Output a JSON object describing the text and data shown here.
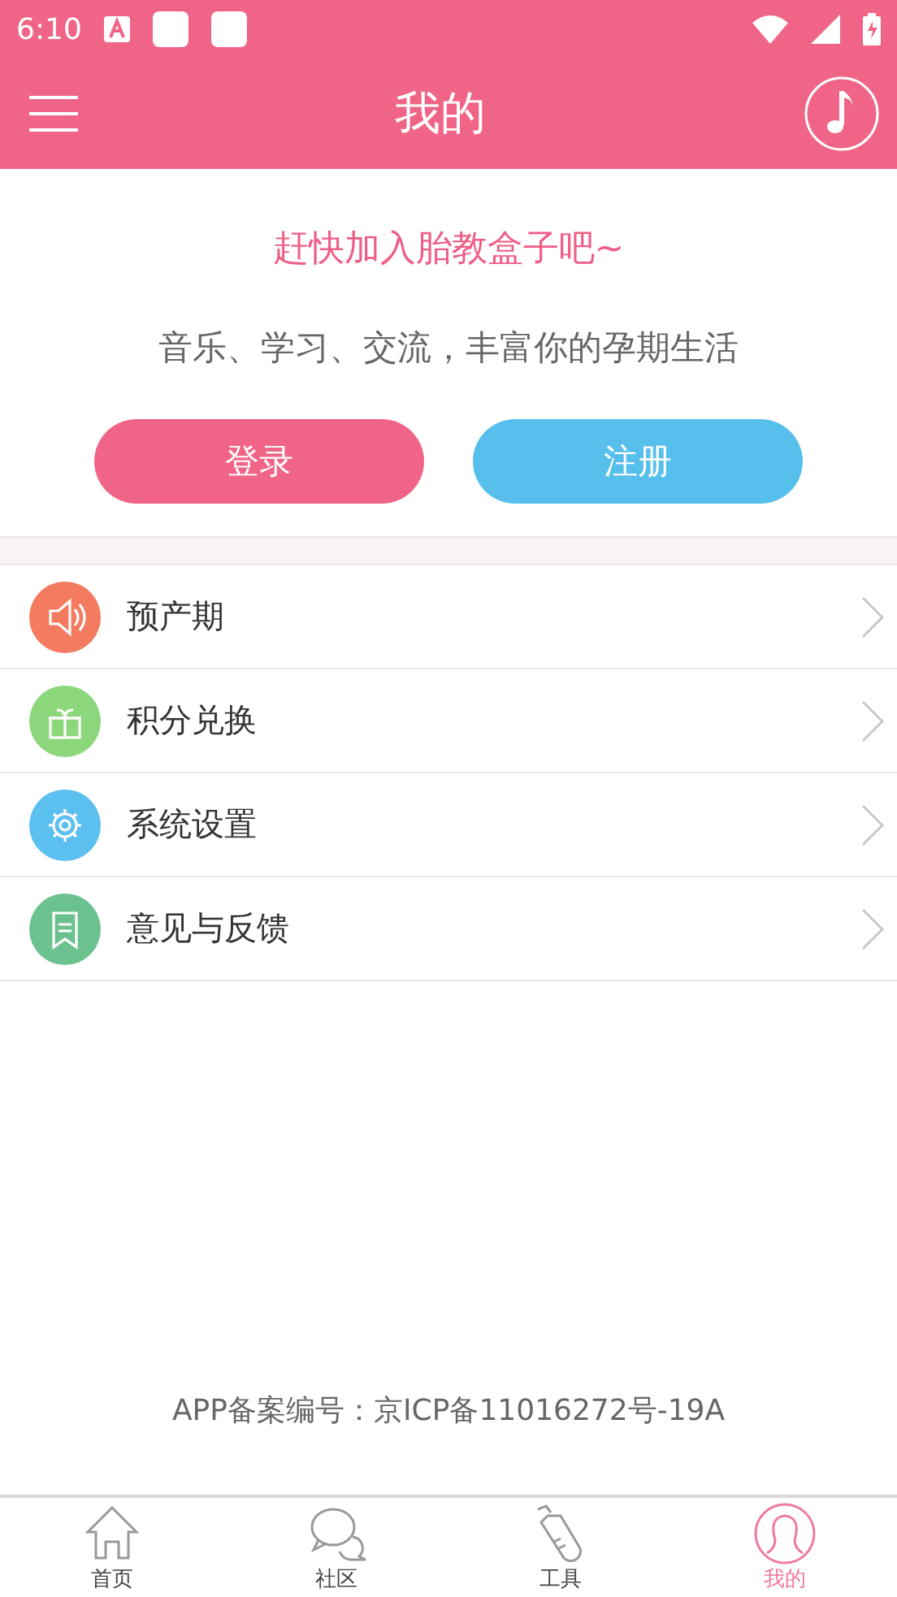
{
  "status_bar": {
    "time": "6:10"
  },
  "app_bar": {
    "title": "我的"
  },
  "welcome": {
    "headline": "赶快加入胎教盒子吧~",
    "subtitle": "音乐、学习、交流，丰富你的孕期生活",
    "buttons": [
      {
        "label": "登录",
        "kind": "login"
      },
      {
        "label": "注册",
        "kind": "register"
      }
    ]
  },
  "menu": [
    {
      "label": "预产期",
      "kind": "speaker",
      "color": "#f47a60"
    },
    {
      "label": "积分兑换",
      "kind": "gift",
      "color": "#8cd67c"
    },
    {
      "label": "系统设置",
      "kind": "gear",
      "color": "#5bbff0"
    },
    {
      "label": "意见与反馈",
      "kind": "bookmark",
      "color": "#6cc28e"
    }
  ],
  "footer": "APP备案编号：京ICP备11016272号-19A",
  "tabs": [
    {
      "label": "首页",
      "kind": "home",
      "selected": false
    },
    {
      "label": "社区",
      "kind": "chat",
      "selected": false
    },
    {
      "label": "工具",
      "kind": "bottle",
      "selected": false
    },
    {
      "label": "我的",
      "kind": "person",
      "selected": true
    }
  ]
}
